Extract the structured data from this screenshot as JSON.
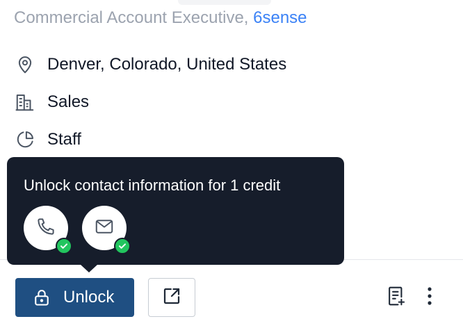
{
  "profile": {
    "job_title": "Commercial Account Executive,",
    "company": "6sense",
    "location": "Denver, Colorado, United States",
    "department": "Sales",
    "level": "Staff"
  },
  "icons": {
    "location": "map-pin-icon",
    "department": "building-icon",
    "level": "pie-chart-icon",
    "phone": "phone-icon",
    "email": "mail-icon",
    "verified": "check-circle-icon",
    "lock": "lock-icon",
    "share": "share-icon",
    "notes": "add-note-icon",
    "more": "more-vertical-icon"
  },
  "tooltip": {
    "text": "Unlock contact information for 1 credit"
  },
  "actions": {
    "unlock_label": "Unlock"
  },
  "colors": {
    "company_link": "#3b82f6",
    "tooltip_bg": "#161d2b",
    "primary_button": "#1f4f82",
    "verified_badge": "#22c55e"
  }
}
